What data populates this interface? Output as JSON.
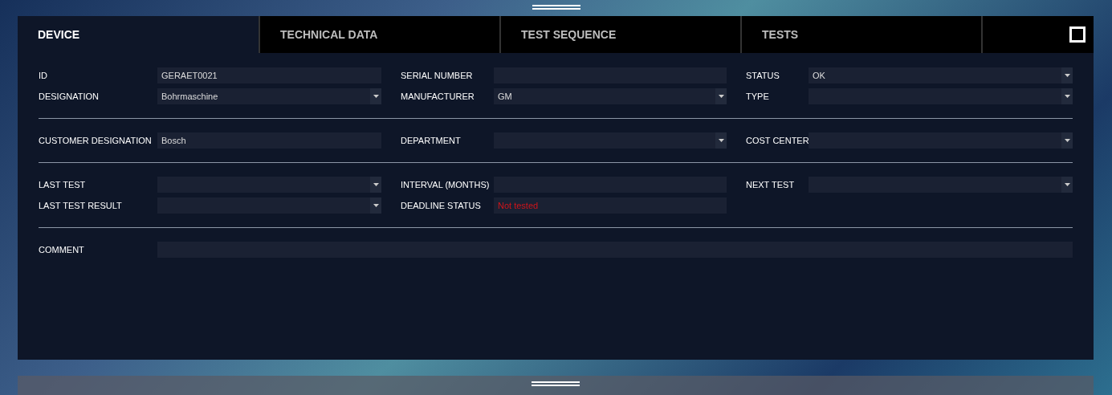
{
  "tabs": [
    {
      "label": "DEVICE",
      "selected": true
    },
    {
      "label": "TECHNICAL DATA",
      "selected": false
    },
    {
      "label": "TEST SEQUENCE",
      "selected": false
    },
    {
      "label": "TESTS",
      "selected": false
    }
  ],
  "sections": [
    {
      "rows": [
        [
          {
            "label": "ID",
            "kind": "text",
            "value": "GERAET0021"
          },
          {
            "label": "SERIAL NUMBER",
            "kind": "text"
          },
          {
            "label": "STATUS",
            "kind": "dropdown",
            "value": "OK"
          }
        ],
        [
          {
            "label": "DESIGNATION",
            "kind": "dropdown",
            "value": "Bohrmaschine"
          },
          {
            "label": "MANUFACTURER",
            "kind": "dropdown",
            "value": "GM"
          },
          {
            "label": "TYPE",
            "kind": "dropdown"
          }
        ]
      ]
    },
    {
      "rows": [
        [
          {
            "label": "CUSTOMER DESIGNATION",
            "kind": "text",
            "value": "Bosch"
          },
          {
            "label": "DEPARTMENT",
            "kind": "dropdown"
          },
          {
            "label": "COST CENTER",
            "kind": "dropdown"
          }
        ]
      ]
    },
    {
      "rows": [
        [
          {
            "label": "LAST TEST",
            "kind": "dropdown"
          },
          {
            "label": "INTERVAL (MONTHS)",
            "kind": "text"
          },
          {
            "label": "NEXT TEST",
            "kind": "dropdown"
          }
        ],
        [
          {
            "label": "LAST TEST RESULT",
            "kind": "dropdown"
          },
          {
            "label": "DEADLINE STATUS",
            "kind": "text",
            "value": "Not tested",
            "alert": true
          },
          null
        ]
      ]
    },
    {
      "rows": [
        [
          {
            "label": "COMMENT",
            "kind": "wide"
          }
        ]
      ]
    }
  ]
}
